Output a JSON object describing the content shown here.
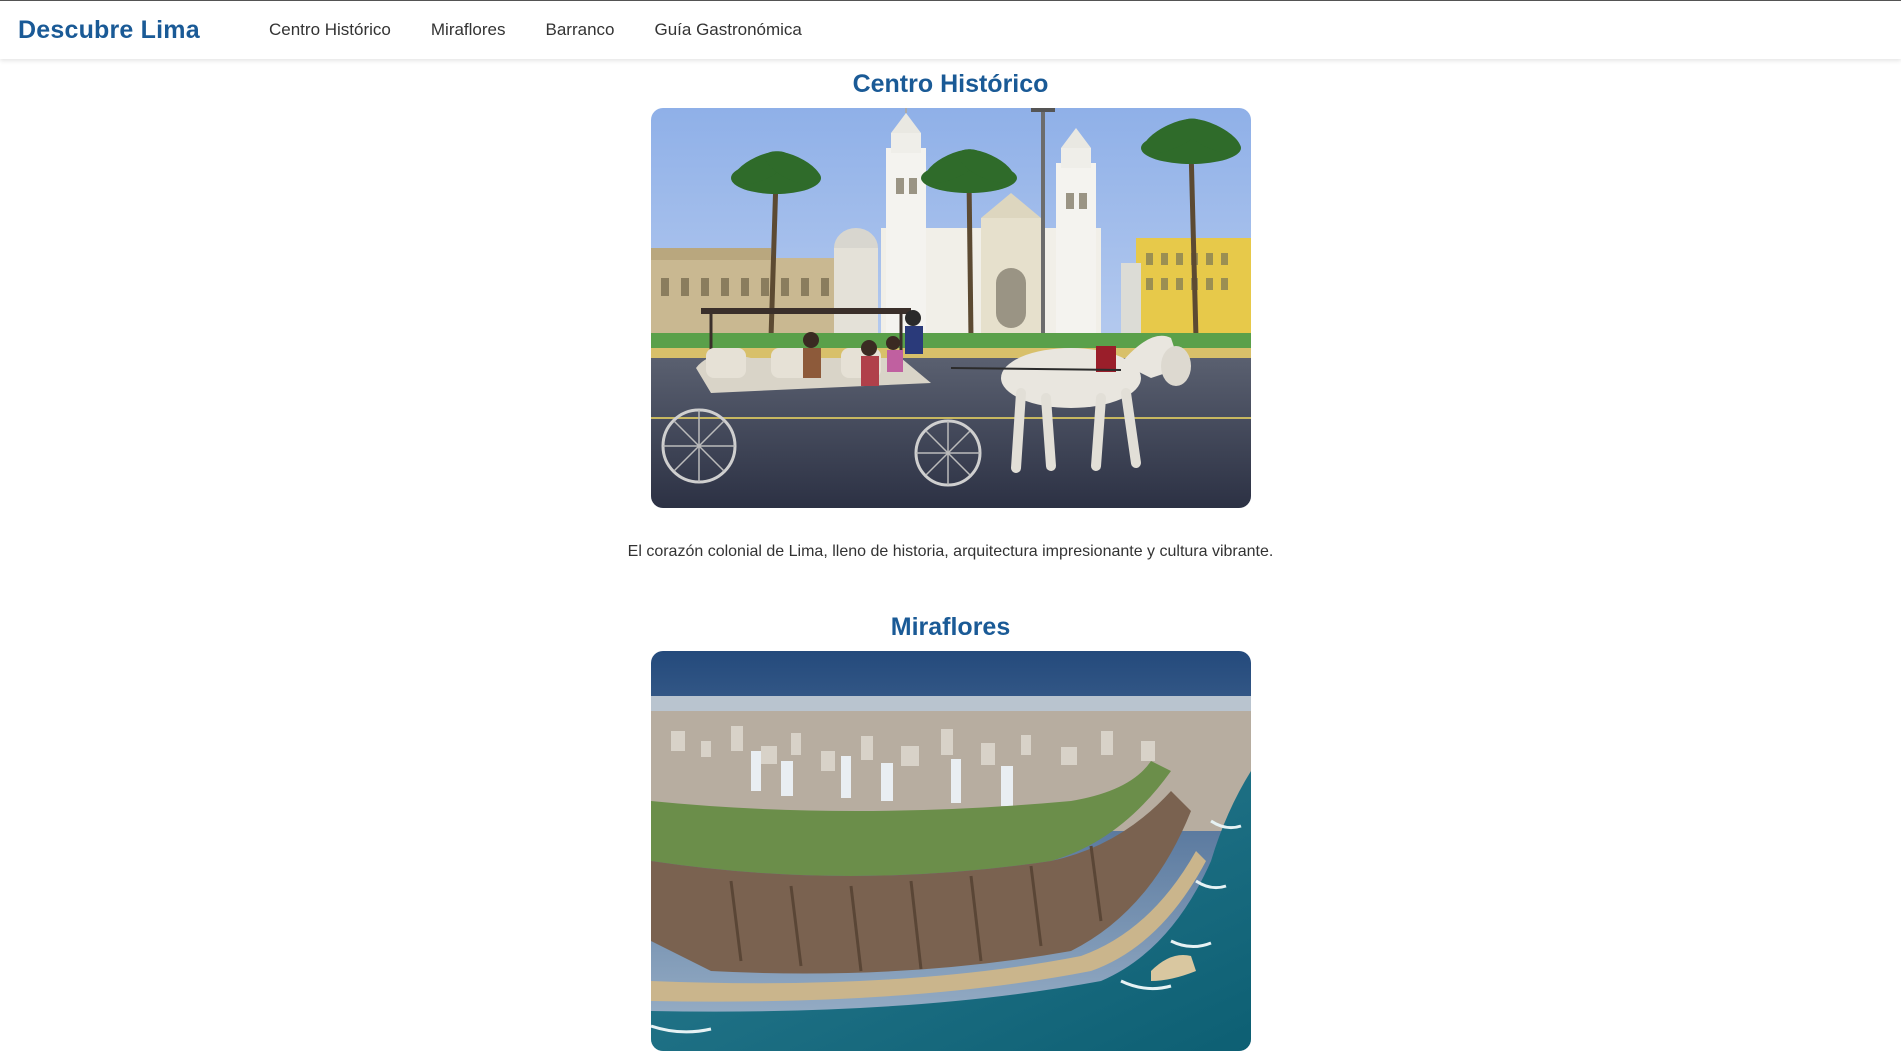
{
  "navbar": {
    "brand": "Descubre Lima",
    "links": [
      "Centro Histórico",
      "Miraflores",
      "Barranco",
      "Guía Gastronómica"
    ]
  },
  "sections": [
    {
      "title": "Centro Histórico",
      "image_alt": "Plaza Mayor de Lima con catedral, palmeras y carruaje tirado por caballo",
      "caption": "El corazón colonial de Lima, lleno de historia, arquitectura impresionante y cultura vibrante."
    },
    {
      "title": "Miraflores",
      "image_alt": "Vista aérea de los acantilados de Miraflores y la costa del Pacífico",
      "caption": ""
    }
  ],
  "colors": {
    "brand": "#1a5a96",
    "text": "#333333"
  }
}
